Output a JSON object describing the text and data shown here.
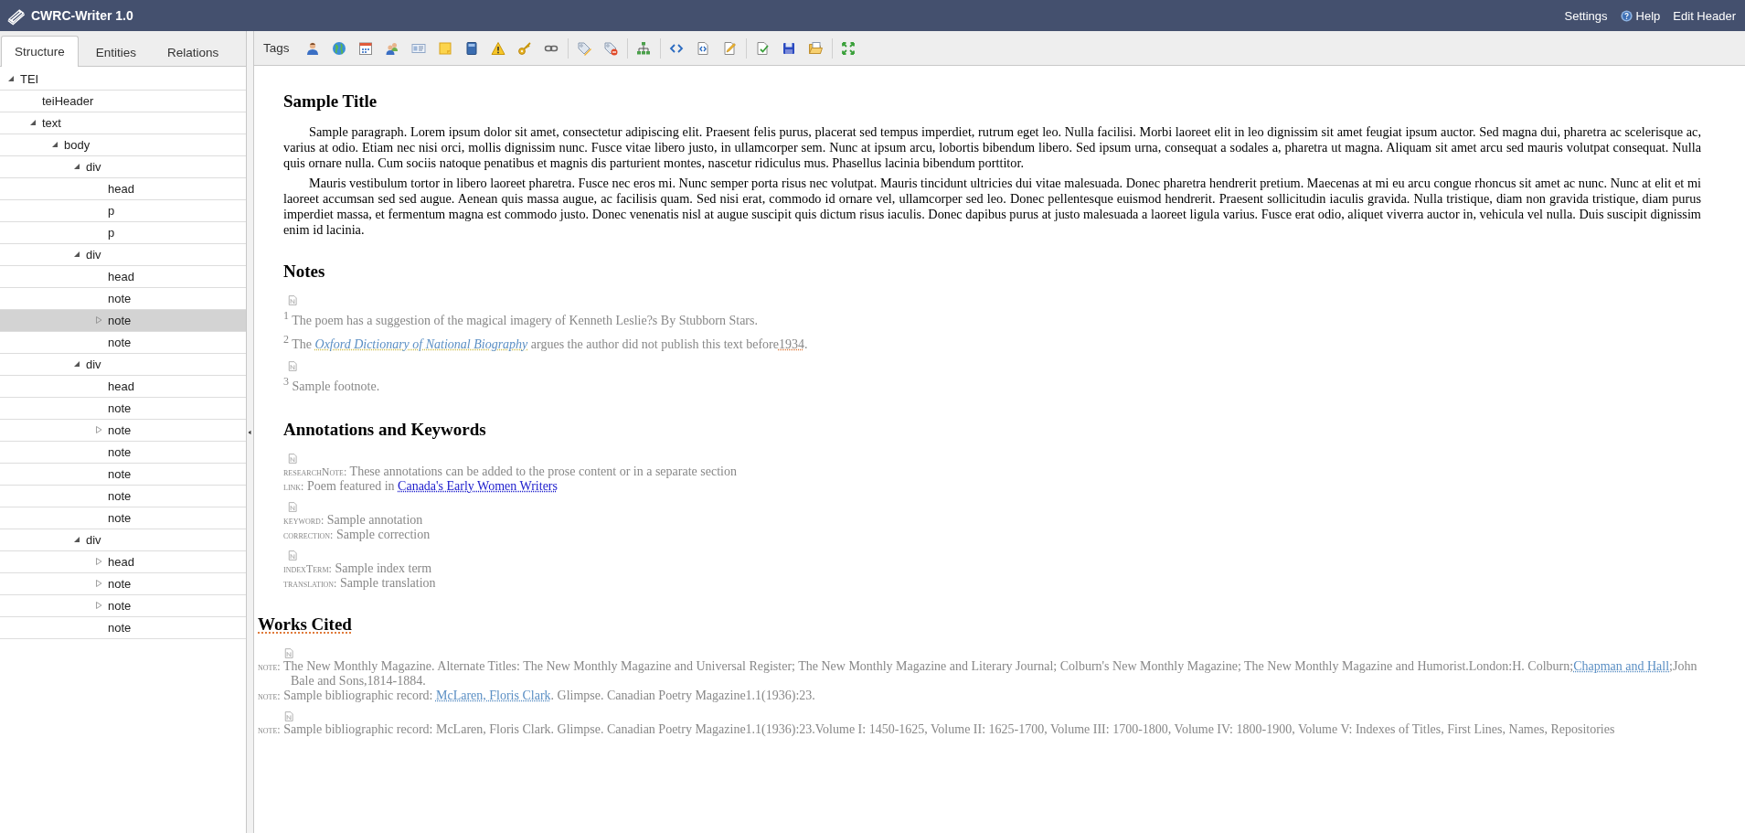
{
  "title_bar": {
    "app_name": "CWRC-Writer 1.0",
    "links": [
      {
        "label": "Settings",
        "kind": "plain"
      },
      {
        "label": "Help",
        "kind": "help"
      },
      {
        "label": "Edit Header",
        "kind": "plain"
      }
    ]
  },
  "sidebar": {
    "tabs": [
      {
        "label": "Structure",
        "selected": true
      },
      {
        "label": "Entities",
        "selected": false
      },
      {
        "label": "Relations",
        "selected": false
      }
    ],
    "tree": [
      {
        "label": "TEI",
        "selected": false,
        "expanded": true,
        "children": [
          {
            "label": "teiHeader",
            "selected": false
          },
          {
            "label": "text",
            "selected": false,
            "expanded": true,
            "children": [
              {
                "label": "body",
                "selected": false,
                "expanded": true,
                "children": [
                  {
                    "label": "div",
                    "selected": false,
                    "expanded": true,
                    "children": [
                      {
                        "label": "head",
                        "selected": false
                      },
                      {
                        "label": "p",
                        "selected": false
                      },
                      {
                        "label": "p",
                        "selected": false
                      }
                    ]
                  },
                  {
                    "label": "div",
                    "selected": false,
                    "expanded": true,
                    "children": [
                      {
                        "label": "head",
                        "selected": false
                      },
                      {
                        "label": "note",
                        "selected": false
                      },
                      {
                        "label": "note",
                        "selected": true,
                        "expanded": false
                      },
                      {
                        "label": "note",
                        "selected": false
                      }
                    ]
                  },
                  {
                    "label": "div",
                    "selected": false,
                    "expanded": true,
                    "children": [
                      {
                        "label": "head",
                        "selected": false
                      },
                      {
                        "label": "note",
                        "selected": false
                      },
                      {
                        "label": "note",
                        "selected": false,
                        "expanded": false
                      },
                      {
                        "label": "note",
                        "selected": false
                      },
                      {
                        "label": "note",
                        "selected": false
                      },
                      {
                        "label": "note",
                        "selected": false
                      },
                      {
                        "label": "note",
                        "selected": false
                      }
                    ]
                  },
                  {
                    "label": "div",
                    "selected": false,
                    "expanded": true,
                    "children": [
                      {
                        "label": "head",
                        "selected": false,
                        "expanded": false
                      },
                      {
                        "label": "note",
                        "selected": false,
                        "expanded": false
                      },
                      {
                        "label": "note",
                        "selected": false,
                        "expanded": false
                      },
                      {
                        "label": "note",
                        "selected": false
                      }
                    ]
                  }
                ]
              }
            ]
          }
        ]
      }
    ]
  },
  "toolbar": {
    "label": "Tags"
  },
  "document": {
    "title": "Sample Title",
    "paragraphs": [
      "Sample paragraph. Lorem ipsum dolor sit amet, consectetur adipiscing elit. Praesent felis purus, placerat sed tempus imperdiet, rutrum eget leo. Nulla facilisi. Morbi laoreet elit in leo dignissim sit amet feugiat ipsum auctor. Sed magna dui, pharetra ac scelerisque ac, varius at odio. Etiam nec nisi orci, mollis dignissim nunc. Fusce vitae libero justo, in ullamcorper sem. Nunc at ipsum arcu, lobortis bibendum libero. Sed ipsum urna, consequat a sodales a, pharetra ut magna. Aliquam sit amet arcu sed mauris volutpat consequat. Nulla quis ornare nulla. Cum sociis natoque penatibus et magnis dis parturient montes, nascetur ridiculus mus. Phasellus lacinia bibendum porttitor.",
      "Mauris vestibulum tortor in libero laoreet pharetra. Fusce nec eros mi. Nunc semper porta risus nec volutpat. Mauris tincidunt ultricies dui vitae malesuada. Donec pharetra hendrerit pretium. Maecenas at mi eu arcu congue rhoncus sit amet ac nunc. Nunc at elit et mi laoreet accumsan sed sed augue. Aenean quis massa augue, ac facilisis quam. Sed nisi erat, commodo id ornare vel, ullamcorper sed leo. Donec pellentesque euismod hendrerit. Praesent sollicitudin iaculis gravida. Nulla tristique, diam non gravida tristique, diam purus imperdiet massa, et fermentum magna est commodo justo. Donec venenatis nisl at augue suscipit quis dictum risus iaculis. Donec dapibus purus at justo malesuada a laoreet ligula varius. Fusce erat odio, aliquet viverra auctor in, vehicula vel nulla. Duis suscipit dignissim enim id lacinia."
    ],
    "sections": [
      {
        "heading": "Notes",
        "kind": "inner",
        "items": [
          {
            "kind": "marker"
          },
          {
            "kind": "footnote",
            "number": "1",
            "segments": [
              {
                "kind": "plain",
                "text": "The poem has a suggestion of the magical imagery of Kenneth Leslie?s By Stubborn Stars."
              }
            ]
          },
          {
            "kind": "footnote",
            "number": "2",
            "segments": [
              {
                "kind": "plain",
                "text": "The "
              },
              {
                "kind": "title",
                "text": "Oxford Dictionary of National Biography"
              },
              {
                "kind": "plain",
                "text": " argues the author did not publish this text before"
              },
              {
                "kind": "date",
                "text": "1934"
              },
              {
                "kind": "plain",
                "text": "."
              }
            ]
          },
          {
            "kind": "marker"
          },
          {
            "kind": "footnote",
            "number": "3",
            "segments": [
              {
                "kind": "plain",
                "text": "Sample footnote."
              }
            ]
          }
        ]
      },
      {
        "heading": "Annotations and Keywords",
        "kind": "inner",
        "items": [
          {
            "kind": "marker"
          },
          {
            "kind": "entry",
            "label": "researchNote:",
            "segments": [
              {
                "kind": "plain",
                "text": "These annotations can be added to the prose content or in a separate section"
              }
            ]
          },
          {
            "kind": "entry",
            "label": "link:",
            "segments": [
              {
                "kind": "plain",
                "text": "Poem featured in "
              },
              {
                "kind": "link",
                "text": "Canada's Early Women Writers"
              }
            ]
          },
          {
            "kind": "marker"
          },
          {
            "kind": "entry",
            "label": "keyword:",
            "segments": [
              {
                "kind": "plain",
                "text": "Sample annotation"
              }
            ]
          },
          {
            "kind": "entry",
            "label": "correction:",
            "segments": [
              {
                "kind": "plain",
                "text": "Sample correction"
              }
            ]
          },
          {
            "kind": "marker"
          },
          {
            "kind": "entry",
            "label": "indexTerm:",
            "segments": [
              {
                "kind": "plain",
                "text": "Sample index term"
              }
            ]
          },
          {
            "kind": "entry",
            "label": "translation:",
            "segments": [
              {
                "kind": "plain",
                "text": "Sample translation"
              }
            ]
          }
        ]
      },
      {
        "heading": "Works Cited",
        "kind": "outer",
        "items": [
          {
            "kind": "marker"
          },
          {
            "kind": "entry",
            "label": "note:",
            "segments": [
              {
                "kind": "plain",
                "text": "The New Monthly Magazine. Alternate Titles: The New Monthly Magazine and Universal Register; The New Monthly Magazine and Literary Journal; Colburn's New Monthly Magazine; The New Monthly Magazine and Humorist.London:H. Colburn;"
              },
              {
                "kind": "entity",
                "text": "Chapman and Hall"
              },
              {
                "kind": "plain",
                "text": ";John Bale and Sons,1814-1884."
              }
            ]
          },
          {
            "kind": "entry",
            "label": "note:",
            "segments": [
              {
                "kind": "plain",
                "text": "Sample bibliographic record: "
              },
              {
                "kind": "entity",
                "text": "McLaren, Floris Clark"
              },
              {
                "kind": "plain",
                "text": ". Glimpse. Canadian Poetry Magazine1.1(1936):23."
              }
            ]
          },
          {
            "kind": "marker"
          },
          {
            "kind": "entry",
            "label": "note:",
            "segments": [
              {
                "kind": "plain",
                "text": "Sample bibliographic record: McLaren, Floris Clark. Glimpse. Canadian Poetry Magazine1.1(1936):23.Volume I: 1450-1625, Volume II: 1625-1700, Volume III: 1700-1800, Volume IV: 1800-1900, Volume V: Indexes of Titles, First Lines, Names, Repositories"
              }
            ]
          }
        ]
      }
    ]
  }
}
